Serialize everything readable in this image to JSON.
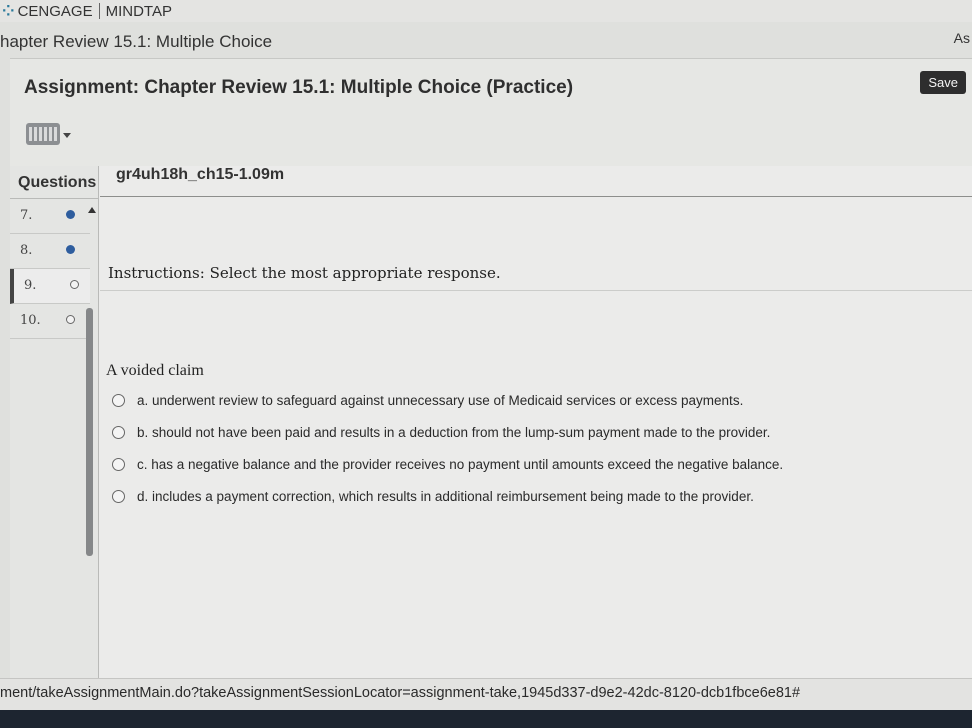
{
  "brand": {
    "name": "CENGAGE",
    "product": "MINDTAP"
  },
  "page_title": "hapter Review 15.1: Multiple Choice",
  "top_right_text": "As",
  "assignment": {
    "title": "Assignment: Chapter Review 15.1: Multiple Choice (Practice)",
    "save_label": "Save"
  },
  "questions": {
    "header": "Questions",
    "items": [
      {
        "number": "7.",
        "status": "answered"
      },
      {
        "number": "8.",
        "status": "answered"
      },
      {
        "number": "9.",
        "status": "unanswered",
        "current": true
      },
      {
        "number": "10.",
        "status": "unanswered"
      }
    ]
  },
  "question": {
    "id": "gr4uh18h_ch15-1.09m",
    "instructions": "Instructions: Select the most appropriate response.",
    "stem": "A voided claim",
    "choices": [
      "a. underwent review to safeguard against unnecessary use of Medicaid services or excess payments.",
      "b. should not have been paid and results in a deduction from the lump-sum payment made to the provider.",
      "c. has a negative balance and the provider receives no payment until amounts exceed the negative balance.",
      "d. includes a payment correction, which results in additional reimbursement being made to the provider."
    ]
  },
  "status_url": "ment/takeAssignmentMain.do?takeAssignmentSessionLocator=assignment-take,1945d337-d9e2-42dc-8120-dcb1fbce6e81#",
  "colors": {
    "answered_dot": "#2e5d9e",
    "save_button": "#2e2e2e"
  }
}
